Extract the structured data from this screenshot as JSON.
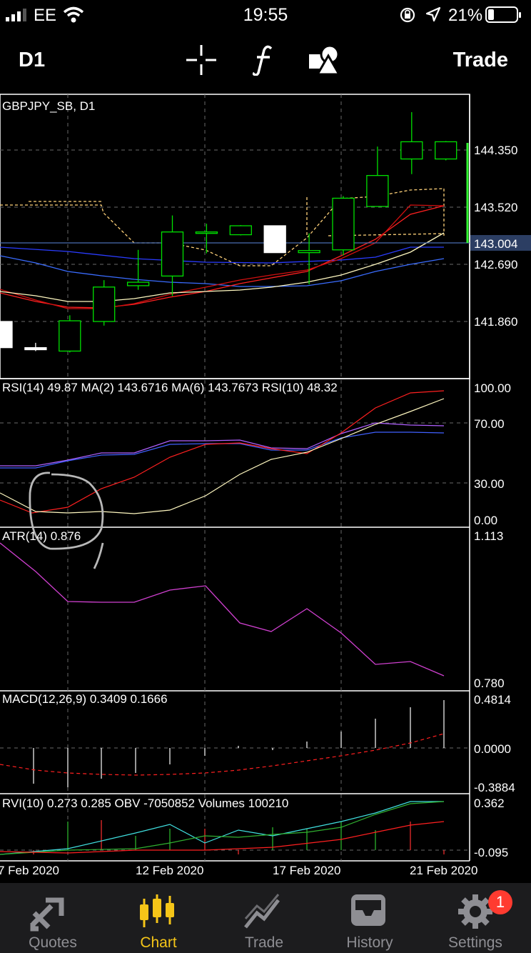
{
  "status_bar": {
    "carrier": "EE",
    "time": "19:55",
    "battery_percent": "21%",
    "battery_level": 0.21,
    "icons": [
      "signal-icon",
      "wifi-icon",
      "rotation-lock-icon",
      "location-icon",
      "battery-icon"
    ]
  },
  "toolbar": {
    "timeframe": "D1",
    "crosshair_icon": "crosshair-icon",
    "indicators_icon": "function-icon",
    "objects_icon": "shapes-icon",
    "trade_label": "Trade"
  },
  "chart": {
    "symbol_label": "GBPJPY_SB, D1",
    "price_axis": [
      "144.350",
      "143.520",
      "142.690",
      "141.860"
    ],
    "current_price": "143.004",
    "x_axis": [
      "7 Feb 2020",
      "12 Feb 2020",
      "17 Feb 2020",
      "21 Feb 2020"
    ],
    "colors": {
      "bull": "#00e000",
      "bear_fill": "#ffffff",
      "grid": "#6a6a6a",
      "current_price_bg": "#2c3e63"
    }
  },
  "chart_data": [
    {
      "type": "candlestick",
      "title": "GBPJPY_SB, D1",
      "ylim": [
        141.3,
        144.75
      ],
      "grid": true,
      "candles": [
        {
          "o": 141.86,
          "h": 141.86,
          "l": 141.48,
          "c": 141.48,
          "color": "white"
        },
        {
          "o": 141.48,
          "h": 141.55,
          "l": 141.43,
          "c": 141.45,
          "color": "white"
        },
        {
          "o": 141.43,
          "h": 141.95,
          "l": 141.41,
          "c": 141.87,
          "color": "green"
        },
        {
          "o": 141.86,
          "h": 142.46,
          "l": 141.8,
          "c": 142.36,
          "color": "green"
        },
        {
          "o": 142.38,
          "h": 142.9,
          "l": 142.32,
          "c": 142.43,
          "color": "green"
        },
        {
          "o": 142.52,
          "h": 143.4,
          "l": 142.23,
          "c": 143.16,
          "color": "green"
        },
        {
          "o": 143.16,
          "h": 143.28,
          "l": 142.85,
          "c": 143.16,
          "color": "green"
        },
        {
          "o": 143.12,
          "h": 143.26,
          "l": 143.11,
          "c": 143.25,
          "color": "green"
        },
        {
          "o": 143.25,
          "h": 143.25,
          "l": 142.86,
          "c": 142.86,
          "color": "white"
        },
        {
          "o": 142.86,
          "h": 143.14,
          "l": 142.4,
          "c": 142.89,
          "color": "green"
        },
        {
          "o": 142.9,
          "h": 143.68,
          "l": 142.82,
          "c": 143.65,
          "color": "green"
        },
        {
          "o": 143.53,
          "h": 144.4,
          "l": 143.53,
          "c": 143.98,
          "color": "green"
        },
        {
          "o": 144.22,
          "h": 144.9,
          "l": 144.0,
          "c": 144.47,
          "color": "green"
        },
        {
          "o": 144.22,
          "h": 144.48,
          "l": 144.2,
          "c": 144.47,
          "color": "green"
        }
      ]
    },
    {
      "type": "line",
      "title": "RSI(14) 49.87 MA(2) 143.6716 MA(6) 143.7673 RSI(10) 48.32",
      "ylim": [
        0,
        100
      ],
      "y_ticks": [
        "100.00",
        "70.00",
        "30.00",
        "0.00"
      ]
    },
    {
      "type": "line",
      "title": "ATR(14) 0.876",
      "y_ticks": [
        "1.113",
        "0.780"
      ]
    },
    {
      "type": "bar",
      "title": "MACD(12,26,9) 0.3409 0.1666",
      "y_ticks": [
        "0.4814",
        "0.0000",
        "-0.3884"
      ]
    },
    {
      "type": "line",
      "title": "RVI(10) 0.273 0.285 OBV -7050852 Volumes 100210",
      "y_ticks": [
        "0.362",
        "-0.095"
      ]
    }
  ],
  "tabs": [
    {
      "label": "Quotes",
      "icon": "quotes-icon",
      "active": false
    },
    {
      "label": "Chart",
      "icon": "candles-icon",
      "active": true
    },
    {
      "label": "Trade",
      "icon": "trade-icon",
      "active": false
    },
    {
      "label": "History",
      "icon": "history-icon",
      "active": false
    },
    {
      "label": "Settings",
      "icon": "gear-icon",
      "active": false
    }
  ],
  "settings_badge": "1"
}
